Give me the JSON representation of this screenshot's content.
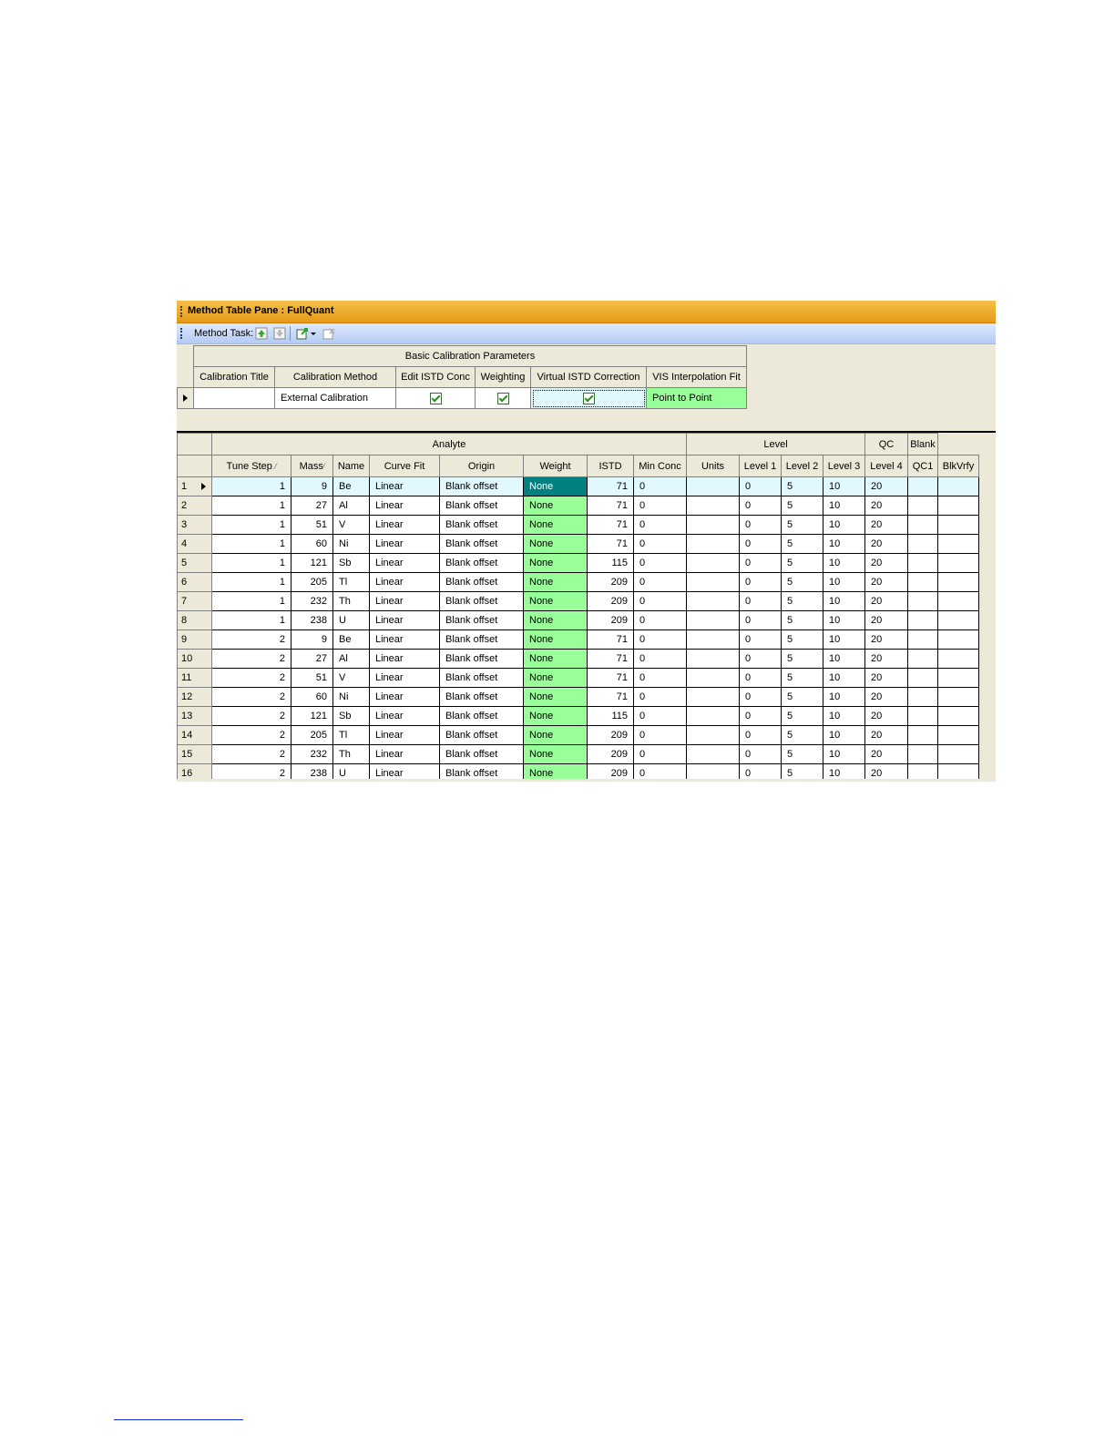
{
  "window": {
    "title": "Method Table Pane : FullQuant"
  },
  "toolbar": {
    "label": "Method Task:",
    "icons": [
      "move-up-icon",
      "move-down-icon",
      "export-icon",
      "dropdown-arrow-icon",
      "clear-icon"
    ]
  },
  "calibration": {
    "group_header": "Basic Calibration Parameters",
    "columns": [
      "Calibration Title",
      "Calibration Method",
      "Edit ISTD Conc",
      "Weighting",
      "Virtual ISTD Correction",
      "VIS Interpolation Fit"
    ],
    "row": {
      "title": "",
      "method": "External Calibration",
      "edit_istd": true,
      "weighting": true,
      "virtual_istd": true,
      "vis_fit": "Point to Point"
    }
  },
  "grid": {
    "group_headers": {
      "analyte": "Analyte",
      "level": "Level",
      "qc": "QC",
      "blank": "Blank"
    },
    "columns": [
      "Tune Step",
      "Mass",
      "Name",
      "Curve Fit",
      "Origin",
      "Weight",
      "ISTD",
      "Min Conc",
      "Units",
      "Level 1",
      "Level 2",
      "Level 3",
      "Level 4",
      "QC1",
      "BlkVrfy"
    ],
    "sort_glyph": "⁄",
    "rows": [
      {
        "n": "1",
        "tune": "1",
        "mass": "9",
        "name": "Be",
        "fit": "Linear",
        "origin": "Blank offset",
        "weight": "None",
        "istd": "71",
        "min": "0",
        "units": "",
        "l1": "0",
        "l2": "5",
        "l3": "10",
        "l4": "20"
      },
      {
        "n": "2",
        "tune": "1",
        "mass": "27",
        "name": "Al",
        "fit": "Linear",
        "origin": "Blank offset",
        "weight": "None",
        "istd": "71",
        "min": "0",
        "units": "",
        "l1": "0",
        "l2": "5",
        "l3": "10",
        "l4": "20"
      },
      {
        "n": "3",
        "tune": "1",
        "mass": "51",
        "name": "V",
        "fit": "Linear",
        "origin": "Blank offset",
        "weight": "None",
        "istd": "71",
        "min": "0",
        "units": "",
        "l1": "0",
        "l2": "5",
        "l3": "10",
        "l4": "20"
      },
      {
        "n": "4",
        "tune": "1",
        "mass": "60",
        "name": "Ni",
        "fit": "Linear",
        "origin": "Blank offset",
        "weight": "None",
        "istd": "71",
        "min": "0",
        "units": "",
        "l1": "0",
        "l2": "5",
        "l3": "10",
        "l4": "20"
      },
      {
        "n": "5",
        "tune": "1",
        "mass": "121",
        "name": "Sb",
        "fit": "Linear",
        "origin": "Blank offset",
        "weight": "None",
        "istd": "115",
        "min": "0",
        "units": "",
        "l1": "0",
        "l2": "5",
        "l3": "10",
        "l4": "20"
      },
      {
        "n": "6",
        "tune": "1",
        "mass": "205",
        "name": "Tl",
        "fit": "Linear",
        "origin": "Blank offset",
        "weight": "None",
        "istd": "209",
        "min": "0",
        "units": "",
        "l1": "0",
        "l2": "5",
        "l3": "10",
        "l4": "20"
      },
      {
        "n": "7",
        "tune": "1",
        "mass": "232",
        "name": "Th",
        "fit": "Linear",
        "origin": "Blank offset",
        "weight": "None",
        "istd": "209",
        "min": "0",
        "units": "",
        "l1": "0",
        "l2": "5",
        "l3": "10",
        "l4": "20"
      },
      {
        "n": "8",
        "tune": "1",
        "mass": "238",
        "name": "U",
        "fit": "Linear",
        "origin": "Blank offset",
        "weight": "None",
        "istd": "209",
        "min": "0",
        "units": "",
        "l1": "0",
        "l2": "5",
        "l3": "10",
        "l4": "20"
      },
      {
        "n": "9",
        "tune": "2",
        "mass": "9",
        "name": "Be",
        "fit": "Linear",
        "origin": "Blank offset",
        "weight": "None",
        "istd": "71",
        "min": "0",
        "units": "",
        "l1": "0",
        "l2": "5",
        "l3": "10",
        "l4": "20"
      },
      {
        "n": "10",
        "tune": "2",
        "mass": "27",
        "name": "Al",
        "fit": "Linear",
        "origin": "Blank offset",
        "weight": "None",
        "istd": "71",
        "min": "0",
        "units": "",
        "l1": "0",
        "l2": "5",
        "l3": "10",
        "l4": "20"
      },
      {
        "n": "11",
        "tune": "2",
        "mass": "51",
        "name": "V",
        "fit": "Linear",
        "origin": "Blank offset",
        "weight": "None",
        "istd": "71",
        "min": "0",
        "units": "",
        "l1": "0",
        "l2": "5",
        "l3": "10",
        "l4": "20"
      },
      {
        "n": "12",
        "tune": "2",
        "mass": "60",
        "name": "Ni",
        "fit": "Linear",
        "origin": "Blank offset",
        "weight": "None",
        "istd": "71",
        "min": "0",
        "units": "",
        "l1": "0",
        "l2": "5",
        "l3": "10",
        "l4": "20"
      },
      {
        "n": "13",
        "tune": "2",
        "mass": "121",
        "name": "Sb",
        "fit": "Linear",
        "origin": "Blank offset",
        "weight": "None",
        "istd": "115",
        "min": "0",
        "units": "",
        "l1": "0",
        "l2": "5",
        "l3": "10",
        "l4": "20"
      },
      {
        "n": "14",
        "tune": "2",
        "mass": "205",
        "name": "Tl",
        "fit": "Linear",
        "origin": "Blank offset",
        "weight": "None",
        "istd": "209",
        "min": "0",
        "units": "",
        "l1": "0",
        "l2": "5",
        "l3": "10",
        "l4": "20"
      },
      {
        "n": "15",
        "tune": "2",
        "mass": "232",
        "name": "Th",
        "fit": "Linear",
        "origin": "Blank offset",
        "weight": "None",
        "istd": "209",
        "min": "0",
        "units": "",
        "l1": "0",
        "l2": "5",
        "l3": "10",
        "l4": "20"
      },
      {
        "n": "16",
        "tune": "2",
        "mass": "238",
        "name": "U",
        "fit": "Linear",
        "origin": "Blank offset",
        "weight": "None",
        "istd": "209",
        "min": "0",
        "units": "",
        "l1": "0",
        "l2": "5",
        "l3": "10",
        "l4": "20"
      }
    ]
  },
  "colors": {
    "title_bar": "#e59a16",
    "toolbar": "#b4cbf5",
    "weight_cell": "#99ff99",
    "selected_weight": "#008080",
    "selected_row": "#e1f8ff"
  }
}
